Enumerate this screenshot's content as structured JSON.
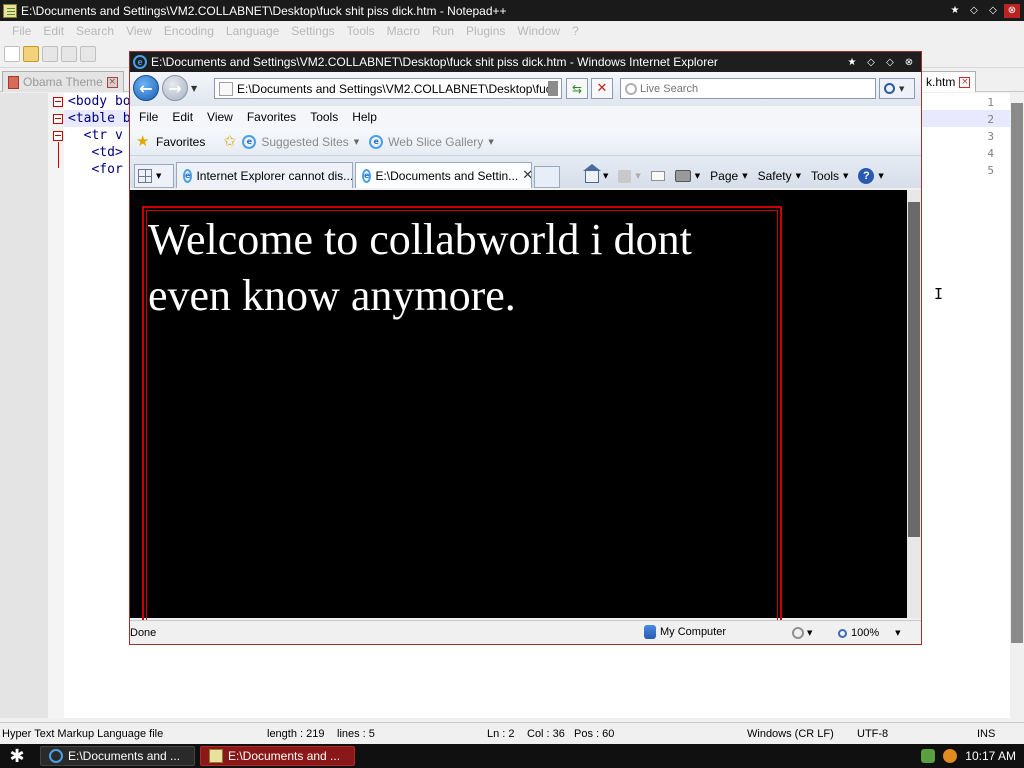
{
  "notepadpp": {
    "title": "E:\\Documents and Settings\\VM2.COLLABNET\\Desktop\\fuck shit piss dick.htm - Notepad++",
    "menu": [
      "File",
      "Edit",
      "Search",
      "View",
      "Encoding",
      "Language",
      "Settings",
      "Tools",
      "Macro",
      "Run",
      "Plugins",
      "Window",
      "?"
    ],
    "tabs": [
      {
        "label": "Obama Theme"
      },
      {
        "label": "k.htm"
      }
    ],
    "lines": [
      {
        "num": "1",
        "code": "<body bo"
      },
      {
        "num": "2",
        "code": "<table b"
      },
      {
        "num": "3",
        "code": "  <tr v"
      },
      {
        "num": "4",
        "code": "   <td>"
      },
      {
        "num": "5",
        "code": "   <for"
      }
    ],
    "status": {
      "filetype": "Hyper Text Markup Language file",
      "length": "length : 219",
      "lines": "lines : 5",
      "ln": "Ln : 2",
      "col": "Col : 36",
      "pos": "Pos : 60",
      "eol": "Windows (CR LF)",
      "encoding": "UTF-8",
      "mode": "INS"
    }
  },
  "ie": {
    "title": "E:\\Documents and Settings\\VM2.COLLABNET\\Desktop\\fuck shit piss dick.htm - Windows Internet Explorer",
    "address": "E:\\Documents and Settings\\VM2.COLLABNET\\Desktop\\fuck shit",
    "search_placeholder": "Live Search",
    "menu": [
      "File",
      "Edit",
      "View",
      "Favorites",
      "Tools",
      "Help"
    ],
    "favorites": {
      "label": "Favorites",
      "suggested": "Suggested Sites",
      "webslice": "Web Slice Gallery"
    },
    "tabs": [
      {
        "label": "Internet Explorer cannot dis..."
      },
      {
        "label": "E:\\Documents and Settin..."
      }
    ],
    "commands": {
      "page": "Page",
      "safety": "Safety",
      "tools": "Tools"
    },
    "content": {
      "heading": "Welcome to collabworld i dont even know anymore."
    },
    "status": {
      "text": "Done",
      "zone": "My Computer",
      "zoom": "100%"
    }
  },
  "taskbar": {
    "items": [
      {
        "label": "E:\\Documents and ..."
      },
      {
        "label": "E:\\Documents and ..."
      }
    ],
    "clock": "10:17 AM"
  }
}
